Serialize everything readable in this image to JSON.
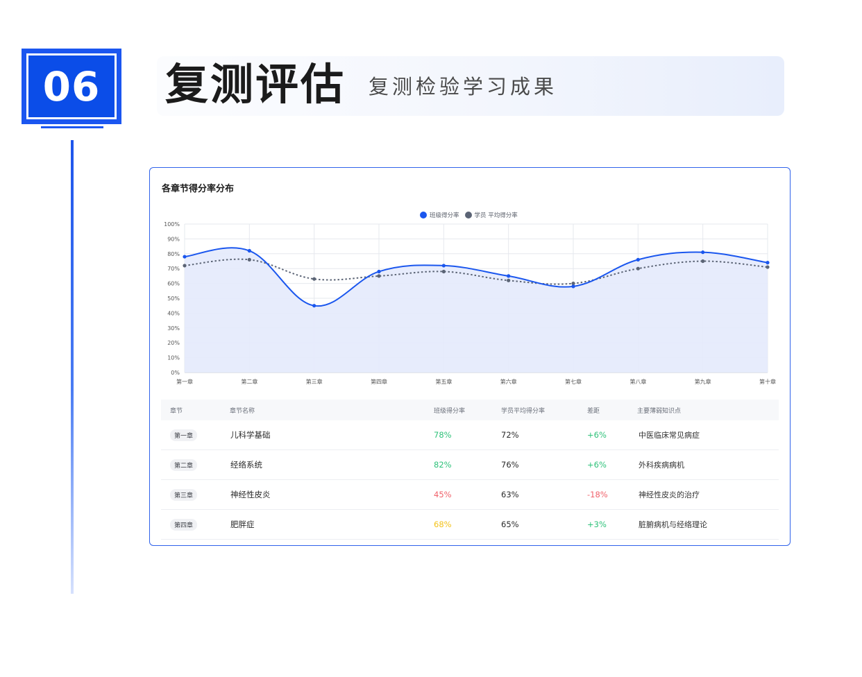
{
  "section": {
    "number": "06",
    "title": "复测评估",
    "subtitle": "复测检验学习成果"
  },
  "card": {
    "title": "各章节得分率分布"
  },
  "chart_data": {
    "type": "line",
    "categories": [
      "第一章",
      "第二章",
      "第三章",
      "第四章",
      "第五章",
      "第六章",
      "第七章",
      "第八章",
      "第九章",
      "第十章"
    ],
    "series": [
      {
        "name": "班级得分率",
        "values": [
          78,
          82,
          45,
          68,
          72,
          65,
          58,
          76,
          81,
          74
        ],
        "color": "#1a56ee",
        "style": "solid",
        "area": true
      },
      {
        "name": "学员 平均得分率",
        "values": [
          72,
          76,
          63,
          65,
          68,
          62,
          60,
          70,
          75,
          71
        ],
        "color": "#5b6475",
        "style": "dotted"
      }
    ],
    "ylim": [
      0,
      100
    ],
    "yticks": [
      "0%",
      "10%",
      "20%",
      "30%",
      "40%",
      "50%",
      "60%",
      "70%",
      "80%",
      "90%",
      "100%"
    ],
    "grid": true,
    "legend": "top-center"
  },
  "table": {
    "headers": [
      "章节",
      "章节名称",
      "班级得分率",
      "学员平均得分率",
      "差距",
      "主要薄弱知识点"
    ],
    "rows": [
      {
        "chapter": "第一章",
        "name": "儿科学基础",
        "class_rate": "78%",
        "avg_rate": "72%",
        "gap": "+6%",
        "weak": "中医临床常见病症",
        "class_color": "#2fc27a",
        "gap_color": "#2fc27a"
      },
      {
        "chapter": "第二章",
        "name": "经络系统",
        "class_rate": "82%",
        "avg_rate": "76%",
        "gap": "+6%",
        "weak": "外科疾病病机",
        "class_color": "#2fc27a",
        "gap_color": "#2fc27a"
      },
      {
        "chapter": "第三章",
        "name": "神经性皮炎",
        "class_rate": "45%",
        "avg_rate": "63%",
        "gap": "-18%",
        "weak": "神经性皮炎的治疗",
        "class_color": "#f0626b",
        "gap_color": "#f0626b"
      },
      {
        "chapter": "第四章",
        "name": "肥胖症",
        "class_rate": "68%",
        "avg_rate": "65%",
        "gap": "+3%",
        "weak": "脏腑病机与经络理论",
        "class_color": "#f3c21a",
        "gap_color": "#2fc27a"
      }
    ]
  }
}
